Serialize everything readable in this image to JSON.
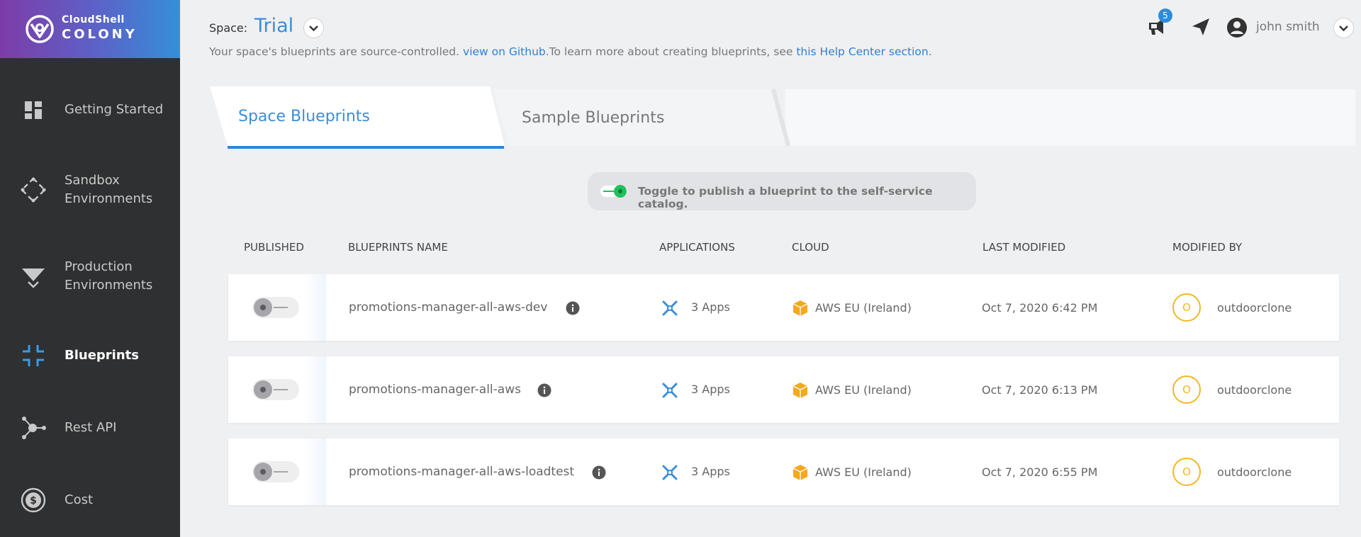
{
  "brand": {
    "top": "CloudShell",
    "bottom": "COLONY"
  },
  "sidebar": {
    "items": [
      {
        "label": "Getting Started",
        "icon": "dashboard-icon",
        "active": false
      },
      {
        "label": "Sandbox Environments",
        "icon": "sandbox-icon",
        "active": false
      },
      {
        "label": "Production Environments",
        "icon": "production-icon",
        "active": false
      },
      {
        "label": "Blueprints",
        "icon": "blueprints-icon",
        "active": true
      },
      {
        "label": "Rest API",
        "icon": "api-icon",
        "active": false
      },
      {
        "label": "Cost",
        "icon": "cost-icon",
        "active": false
      }
    ]
  },
  "header": {
    "space_label": "Space:",
    "space_name": "Trial",
    "info_text_1": "Your space's blueprints are source-controlled.",
    "github_link": "view on Github",
    "info_text_2": ".To learn more about creating blueprints, see",
    "help_link": "this Help Center section",
    "info_text_3": ".",
    "notifications_count": "5",
    "user_name": "john smith"
  },
  "tabs": {
    "space": "Space Blueprints",
    "sample": "Sample Blueprints"
  },
  "hint": {
    "text": "Toggle to publish a blueprint to the self-service catalog."
  },
  "table": {
    "columns": [
      "PUBLISHED",
      "BLUEPRINTS NAME",
      "APPLICATIONS",
      "CLOUD",
      "LAST MODIFIED",
      "MODIFIED BY"
    ],
    "rows": [
      {
        "published": false,
        "name": "promotions-manager-all-aws-dev",
        "apps": "3 Apps",
        "cloud": "AWS EU (Ireland)",
        "modified": "Oct 7, 2020 6:42 PM",
        "avatar": "O",
        "modified_by": "outdoorclone"
      },
      {
        "published": false,
        "name": "promotions-manager-all-aws",
        "apps": "3 Apps",
        "cloud": "AWS EU (Ireland)",
        "modified": "Oct 7, 2020 6:13 PM",
        "avatar": "O",
        "modified_by": "outdoorclone"
      },
      {
        "published": false,
        "name": "promotions-manager-all-aws-loadtest",
        "apps": "3 Apps",
        "cloud": "AWS EU (Ireland)",
        "modified": "Oct 7, 2020 6:55 PM",
        "avatar": "O",
        "modified_by": "outdoorclone"
      }
    ]
  },
  "colors": {
    "accent": "#3a8ed8",
    "sidebar_bg": "#2f3031",
    "avatar": "#f2b824",
    "aws": "#f4a81c",
    "toggle_on": "#20c05c"
  }
}
